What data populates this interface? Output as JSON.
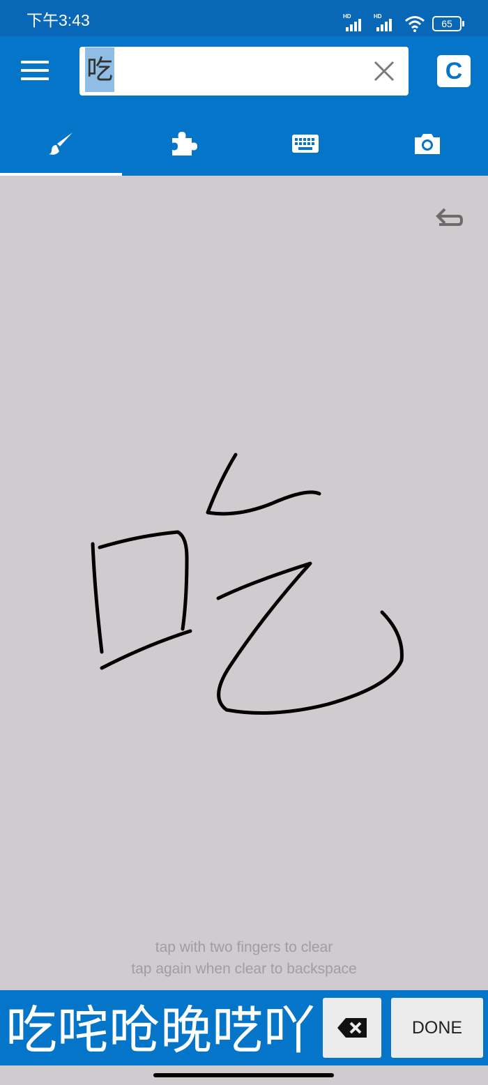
{
  "status_bar": {
    "time": "下午3:43",
    "network_badge_1": "HD",
    "network_badge_2": "HD",
    "battery_level": "65"
  },
  "header": {
    "search_value": "吃",
    "mode_badge": "C"
  },
  "tabs": [
    {
      "icon": "brush-icon",
      "selected": true
    },
    {
      "icon": "puzzle-icon",
      "selected": false
    },
    {
      "icon": "keyboard-icon",
      "selected": false
    },
    {
      "icon": "camera-icon",
      "selected": false
    }
  ],
  "canvas": {
    "hint_line1": "tap with two fingers to clear",
    "hint_line2": "tap again when clear to backspace"
  },
  "bottom_bar": {
    "candidates": "吃咤呛晚呓吖",
    "done_label": "DONE"
  },
  "colors": {
    "status_bar": "#0967b7",
    "header": "#0475c9",
    "canvas": "#d0cbcf",
    "selection": "#8fbde3"
  }
}
